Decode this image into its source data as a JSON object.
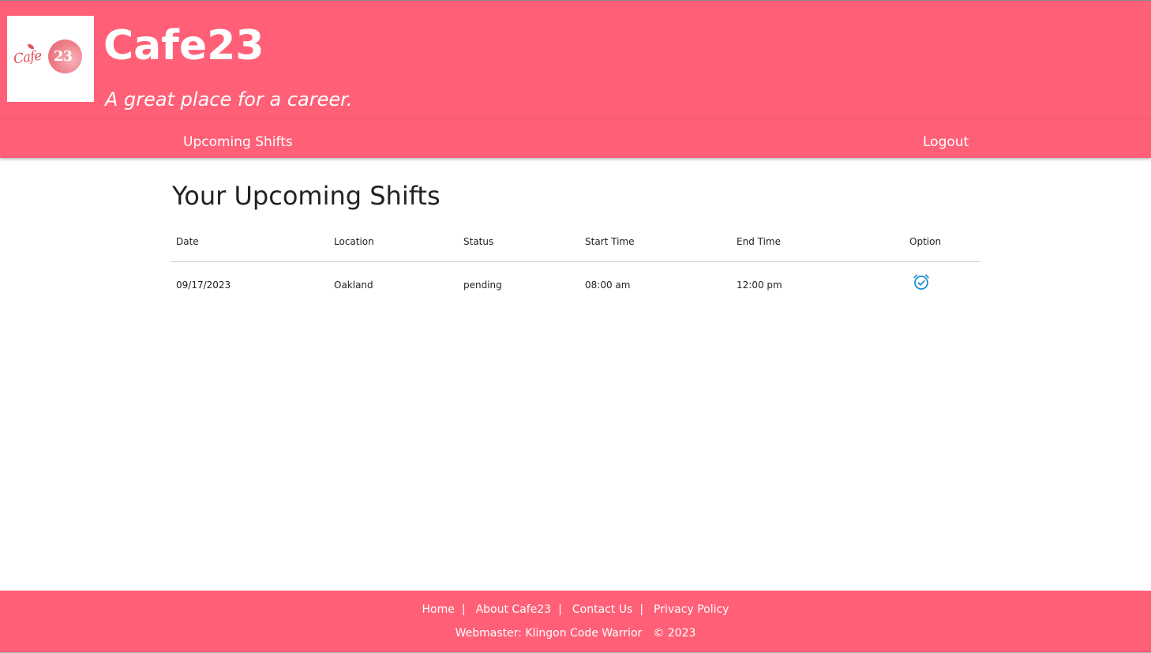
{
  "header": {
    "logo": {
      "script_text": "Cafe",
      "number_text": "23"
    },
    "title": "Cafe23",
    "tagline": "A great place for a career."
  },
  "nav": {
    "left_link": "Upcoming Shifts",
    "right_link": "Logout"
  },
  "main": {
    "heading": "Your Upcoming Shifts",
    "table": {
      "columns": [
        "Date",
        "Location",
        "Status",
        "Start Time",
        "End Time",
        "Option"
      ],
      "rows": [
        {
          "date": "09/17/2023",
          "location": "Oakland",
          "status": "pending",
          "start_time": "08:00 am",
          "end_time": "12:00 pm",
          "option_icon": "alarm-clock-check-icon"
        }
      ]
    }
  },
  "footer": {
    "links": [
      "Home",
      "About Cafe23",
      "Contact Us",
      "Privacy Policy"
    ],
    "separator": "|",
    "credit": "Webmaster: Klingon Code Warrior",
    "copyright": "© 2023"
  },
  "colors": {
    "brand": "#ff6077",
    "icon_accent": "#1a8fd6"
  }
}
